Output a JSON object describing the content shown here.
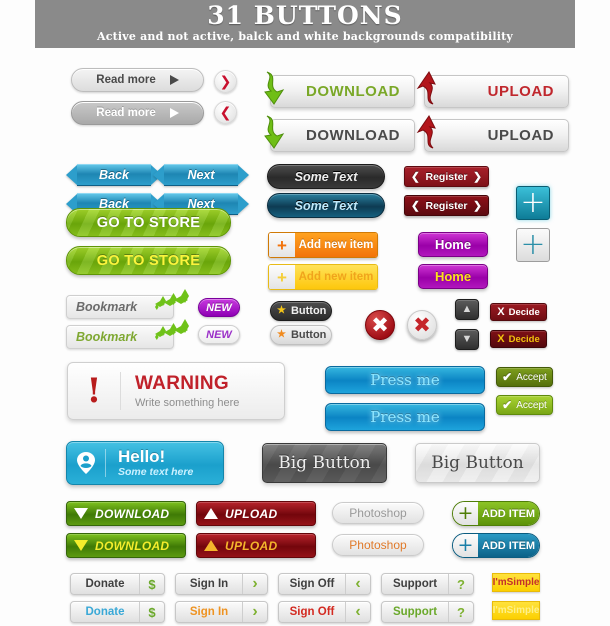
{
  "header": {
    "title": "31 BUTTONS",
    "subtitle": "Active and not active, balck and white backgrounds compatibility",
    "bg": "#8a8a8a"
  },
  "buttons": {
    "read_more_1": "Read more",
    "read_more_2": "Read more",
    "circle_next": "❯",
    "circle_prev": "❮",
    "back_1": "Back",
    "next_1": "Next",
    "back_2": "Back",
    "next_2": "Next",
    "download_ribbon_1": "DOWNLOAD",
    "upload_ribbon_1": "UPLOAD",
    "download_ribbon_2": "DOWNLOAD",
    "upload_ribbon_2": "UPLOAD",
    "some_text_1": "Some Text",
    "some_text_2": "Some Text",
    "register_1": "Register",
    "register_2": "Register",
    "register_left_chevron": "❮",
    "register_right_chevron": "❯",
    "add_new_item_1": "Add new item",
    "add_new_item_2": "Add new item",
    "home_1": "Home",
    "home_2": "Home",
    "plus_glyph": "+",
    "go_to_store_1": "GO TO STORE",
    "go_to_store_2": "GO TO STORE",
    "bookmark_1": "Bookmark",
    "bookmark_2": "Bookmark",
    "new_badge_1": "NEW",
    "new_badge_2": "NEW",
    "star_button_1": "Button",
    "star_button_2": "Button",
    "star_glyph": "★",
    "x_glyph": "✖",
    "up_glyph": "▲",
    "down_glyph": "▼",
    "decide_1": "Decide",
    "decide_2": "Decide",
    "decide_x": "X",
    "warning_title": "WARNING",
    "warning_subtitle": "Write something here",
    "warning_mark": "!",
    "press_me_1": "Press me",
    "press_me_2": "Press me",
    "accept_1": "Accept",
    "accept_2": "Accept",
    "check_glyph": "✔",
    "hello_title": "Hello!",
    "hello_subtitle": "Some text here",
    "big_button_1": "Big Button",
    "big_button_2": "Big Button",
    "download_flat_1": "DOWNLOAD",
    "upload_flat_1": "UPLOAD",
    "download_flat_2": "DOWNLOAD",
    "upload_flat_2": "UPLOAD",
    "photoshop_1": "Photoshop",
    "photoshop_2": "Photoshop",
    "add_item_1": "ADD ITEM",
    "add_item_2": "ADD ITEM",
    "donate_1": "Donate",
    "donate_2": "Donate",
    "dollar_glyph": "$",
    "sign_in_1": "Sign In",
    "sign_in_2": "Sign In",
    "gt_glyph": "›",
    "sign_off_1": "Sign Off",
    "sign_off_2": "Sign Off",
    "lt_glyph": "‹",
    "support_1": "Support",
    "support_2": "Support",
    "question_glyph": "?",
    "simple_1": "I'mSimple",
    "simple_2": "I'mSimple"
  },
  "colors": {
    "green": "#6fae0b",
    "red": "#b81c1c",
    "blue": "#1ba0cc",
    "orange": "#f2730a",
    "yellow": "#fcd000",
    "magenta": "#9a00a8",
    "teal": "#0e7c97",
    "grey": "#8a8a8a"
  }
}
